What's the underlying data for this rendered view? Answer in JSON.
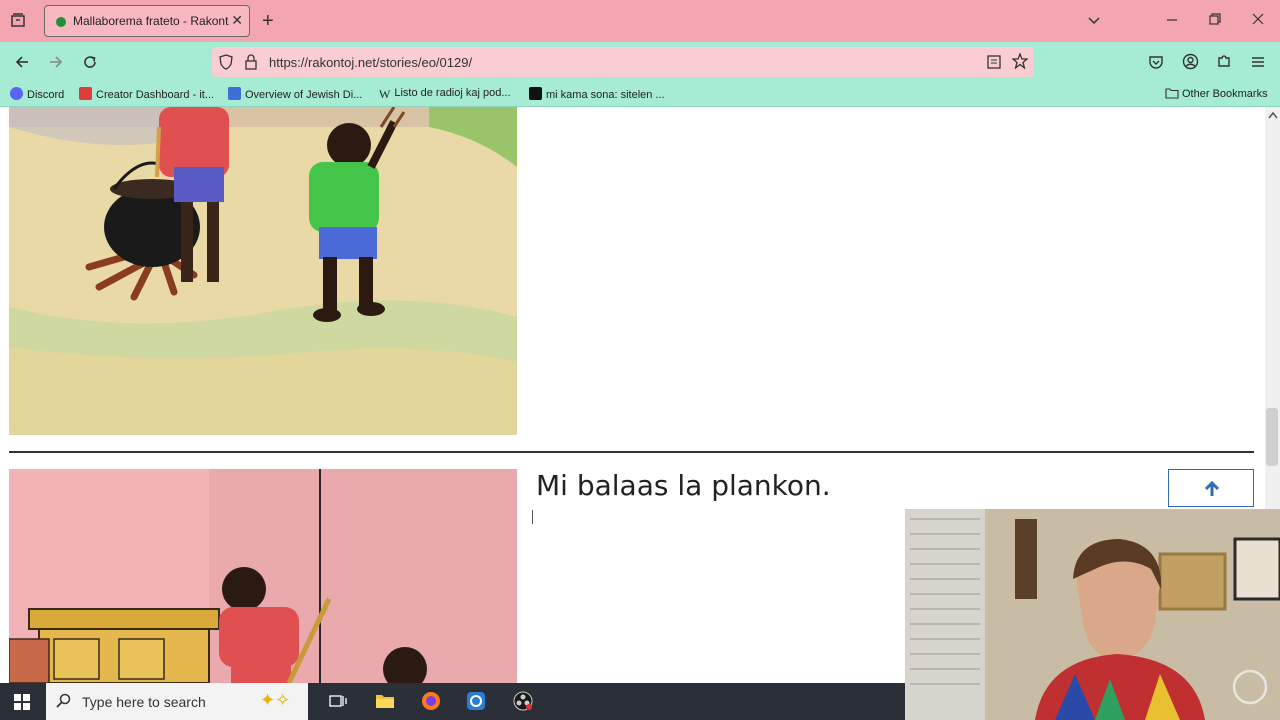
{
  "tab": {
    "title": "Mallaborema frateto - Rakontoj"
  },
  "navbar": {
    "url": "https://rakontoj.net/stories/eo/0129/"
  },
  "bookmarks": [
    {
      "label": "Discord",
      "color": "#5865f2"
    },
    {
      "label": "Creator Dashboard - it...",
      "color": "#e23b3b"
    },
    {
      "label": "Overview of Jewish Di...",
      "color": "#3d6fd6"
    },
    {
      "label": "Listo de radioj kaj pod...",
      "color": "#222222"
    },
    {
      "label": "mi kama sona: sitelen ...",
      "color": "#111111"
    }
  ],
  "other_bookmarks": "Other Bookmarks",
  "story": {
    "caption": "Mi balaas la plankon."
  },
  "taskbar": {
    "search_placeholder": "Type here to search"
  }
}
